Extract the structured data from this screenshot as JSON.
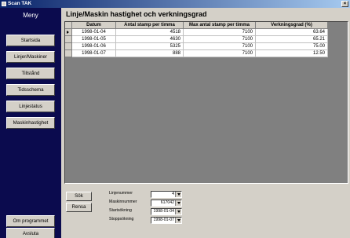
{
  "window": {
    "title": "Scan TAK"
  },
  "menu": {
    "title": "Meny",
    "items": [
      {
        "label": "Startsida"
      },
      {
        "label": "Linjer/Maskiner"
      },
      {
        "label": "Tillstånd"
      },
      {
        "label": "Tidsschema"
      },
      {
        "label": "Linjestatus"
      },
      {
        "label": "Maskinhastighet"
      }
    ],
    "about": "Om programmet",
    "quit": "Avsluta"
  },
  "page": {
    "title": "Linje/Maskin hastighet och verkningsgrad"
  },
  "table": {
    "headers": [
      "Datum",
      "Antal stamp per timma",
      "Max antal stamp per timma",
      "Verkningsgrad (%)"
    ],
    "rows": [
      [
        "1998-01-04",
        "4518",
        "7100",
        "63.64"
      ],
      [
        "1998-01-05",
        "4630",
        "7100",
        "65.21"
      ],
      [
        "1998-01-06",
        "5325",
        "7100",
        "75.00"
      ],
      [
        "1998-01-07",
        "888",
        "7100",
        "12.50"
      ]
    ]
  },
  "actions": {
    "search": "Sök",
    "clear": "Rensa"
  },
  "filters": [
    {
      "label": "Linjenummer",
      "value": "4"
    },
    {
      "label": "Maskinnummer",
      "value": "617042"
    },
    {
      "label": "Startsökning",
      "value": "1998-01-04"
    },
    {
      "label": "Stoppsökning",
      "value": "1998-01-07"
    }
  ],
  "colors": {
    "sidebar": "#0b0b4e",
    "grid_background": "#808080",
    "titlebar": "#0a246a"
  }
}
